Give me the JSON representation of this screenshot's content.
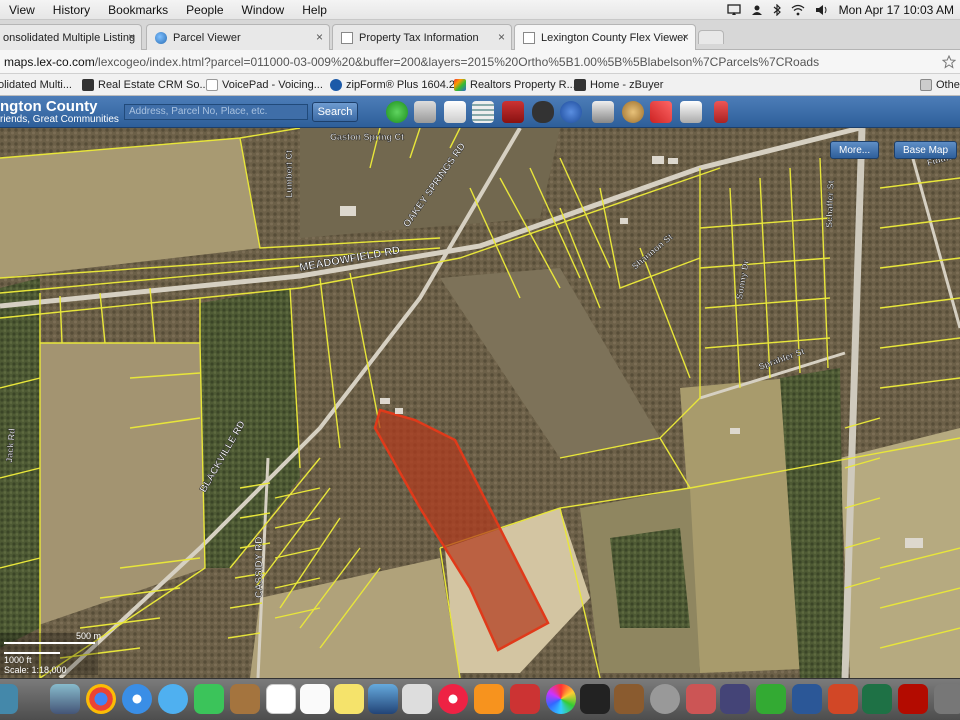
{
  "menubar": {
    "items": [
      "View",
      "History",
      "Bookmarks",
      "People",
      "Window",
      "Help"
    ],
    "clock": "Mon Apr 17  10:03 AM"
  },
  "tabs": [
    {
      "label": "onsolidated Multiple Listing",
      "active": false
    },
    {
      "label": "Parcel Viewer",
      "active": false
    },
    {
      "label": "Property Tax Information",
      "active": false
    },
    {
      "label": "Lexington County Flex Viewer",
      "active": true
    }
  ],
  "address": {
    "host": "maps.lex-co.com",
    "path": "/lexcogeo/index.html?parcel=011000-03-009%20&buffer=200&layers=2015%20Ortho%5B1.00%5B%5Blabelson%7CParcels%7CRoads"
  },
  "bookmarks": [
    {
      "label": "olidated Multi...",
      "icon": "bookmark-icon"
    },
    {
      "label": "Real Estate CRM So...",
      "icon": "crm-icon"
    },
    {
      "label": "VoicePad - Voicing...",
      "icon": "voicepad-icon"
    },
    {
      "label": "zipForm® Plus 1604.2",
      "icon": "zipform-icon"
    },
    {
      "label": "Realtors Property R...",
      "icon": "realtors-icon"
    },
    {
      "label": "Home - zBuyer",
      "icon": "zbuyer-icon"
    },
    {
      "label": "Othe",
      "icon": "folder-icon"
    }
  ],
  "gis": {
    "title": "ngton County",
    "tagline": "riends, Great Communities",
    "search_placeholder": "Address, Parcel No, Place, etc.",
    "search_button": "Search",
    "more_button": "More...",
    "basemap_button": "Base Map"
  },
  "map_labels": {
    "meadowfield": "MEADOWFIELD RD",
    "oakey": "OAKEY SPRINGS RD",
    "blackville": "BLACKVILLE RD",
    "cassidy": "CASSIDY RD",
    "gaston": "Gaston Spring Ct",
    "lumbert": "Lumbert Ct",
    "shannon": "Shannon St",
    "sonny": "Sonny Dr",
    "sprahler": "Sprahler St",
    "jack": "Jack Rd",
    "schaffer": "Schaffer St",
    "fiddler": "Fiddler",
    "scale_m": "500 m",
    "scale_ft": "1000 ft",
    "scale_ratio": "Scale: 1:18,000"
  },
  "colors": {
    "parcel_line": "#e8e63a",
    "selected_parcel": "#d43a1f",
    "toolbar": "#3a6aa5"
  }
}
